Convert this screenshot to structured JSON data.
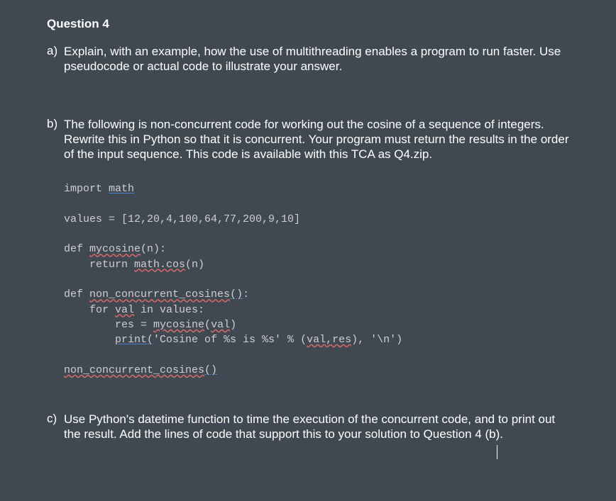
{
  "title": "Question 4",
  "parts": {
    "a": {
      "label": "a)",
      "text": "Explain, with an example, how the use of multithreading enables a  program to run faster. Use pseudocode or actual code to illustrate your  answer."
    },
    "b": {
      "label": "b)",
      "text": "The following is non-concurrent code for working out the cosine of a sequence of integers. Rewrite this in Python so that it is concurrent. Your program must return the results in the order of the input sequence. This code is available with this TCA  as Q4.zip."
    },
    "c": {
      "label": "c)",
      "text": "Use Python's datetime function to time the execution of the concurrent code, and to print out the result. Add the lines of code that support this to your solution to Question 4 (b)."
    }
  },
  "code": {
    "l1_import": "import ",
    "l1_math": "math",
    "l2_values": "values = [12,20,4,100,64,77,200,9,10]",
    "l3_def": "def ",
    "l3_mycosine": "mycosine",
    "l3_tail": "(n):",
    "l4_return": "    return ",
    "l4_mathcos": "math.cos",
    "l4_tail": "(n)",
    "l5_def": "def ",
    "l5_fn": "non_concurrent_cosines",
    "l5_paren": "()",
    "l5_colon": ":",
    "l6_for": "    for ",
    "l6_val": "val",
    "l6_tail": " in values:",
    "l7_pre": "        res = ",
    "l7_mycosine": "mycosine",
    "l7_paren_open": "(",
    "l7_val": "val",
    "l7_paren_close": ")",
    "l8_pre": "        ",
    "l8_print": "print(",
    "l8_str": "'Cosine of %s is %s' % (",
    "l8_valres": "val,res",
    "l8_tail": "), '\\n')",
    "l9_call": "non_concurrent_cosines",
    "l9_paren": "()"
  }
}
